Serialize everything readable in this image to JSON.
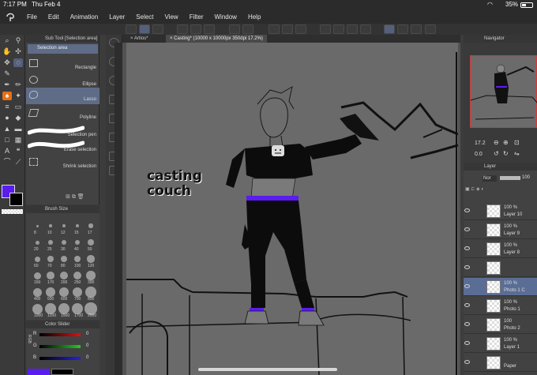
{
  "status": {
    "time": "7:17 PM",
    "date": "Thu Feb 4",
    "battery": "35%"
  },
  "menu": [
    "File",
    "Edit",
    "Animation",
    "Layer",
    "Select",
    "View",
    "Filter",
    "Window",
    "Help"
  ],
  "tabs": [
    {
      "label": "Artios*",
      "active": false
    },
    {
      "label": "Casting* (10000 x 10000px 350dpi 17.2%)",
      "active": true
    }
  ],
  "subtool": {
    "title": "Sub Tool [Selection area]",
    "group": "Selection area",
    "items": [
      {
        "label": "Rectangle",
        "selected": false
      },
      {
        "label": "Ellipse",
        "selected": false
      },
      {
        "label": "Lasso",
        "selected": true
      },
      {
        "label": "Polyline",
        "selected": false
      },
      {
        "label": "Selection pen",
        "selected": false
      },
      {
        "label": "Erase selection",
        "selected": false
      },
      {
        "label": "Shrink selection",
        "selected": false
      }
    ]
  },
  "brushsize": {
    "title": "Brush Size",
    "rows": [
      [
        "8",
        "10",
        "12",
        "15",
        "17"
      ],
      [
        "20",
        "25",
        "30",
        "40",
        "50"
      ],
      [
        "60",
        "70",
        "80",
        "100",
        "120"
      ],
      [
        "150",
        "170",
        "200",
        "250",
        "300"
      ],
      [
        "400",
        "500",
        "600",
        "700",
        "800"
      ],
      [
        "1000",
        "1200",
        "1500",
        "1700",
        "2000"
      ]
    ]
  },
  "colorslider": {
    "title": "Color Slider",
    "mode": "RGB",
    "channels": [
      {
        "name": "R",
        "value": "0",
        "color": "#d11"
      },
      {
        "name": "G",
        "value": "0",
        "color": "#2c2"
      },
      {
        "name": "B",
        "value": "0",
        "color": "#22d"
      }
    ]
  },
  "colors": {
    "main": "#5a1cf0",
    "sub": "#000000",
    "accent": "#e3701a"
  },
  "canvas": {
    "caption_line1": "casting",
    "caption_line2": "couch"
  },
  "navigator": {
    "title": "Navigator",
    "zoom": "17.2",
    "rotation": "0.0"
  },
  "layers": {
    "title": "Layer",
    "blend": "Nor",
    "opacity": "100",
    "rows": [
      {
        "pct": "100 %",
        "mode": "N",
        "name": "Layer 10",
        "selected": false
      },
      {
        "pct": "100 %",
        "mode": "N",
        "name": "Layer 9",
        "selected": false
      },
      {
        "pct": "100 %",
        "mode": "N",
        "name": "Layer 8",
        "selected": false
      },
      {
        "pct": "",
        "mode": "",
        "name": "",
        "selected": false
      },
      {
        "pct": "100 %",
        "mode": "N",
        "name": "Photo 1 C",
        "selected": true
      },
      {
        "pct": "100 %",
        "mode": "N",
        "name": "Photo 1",
        "selected": false
      },
      {
        "pct": "100",
        "mode": "",
        "name": "Photo 2",
        "selected": false
      },
      {
        "pct": "100 %",
        "mode": "N",
        "name": "Layer 1",
        "selected": false
      },
      {
        "pct": "",
        "mode": "",
        "name": "Paper",
        "selected": false
      }
    ]
  }
}
